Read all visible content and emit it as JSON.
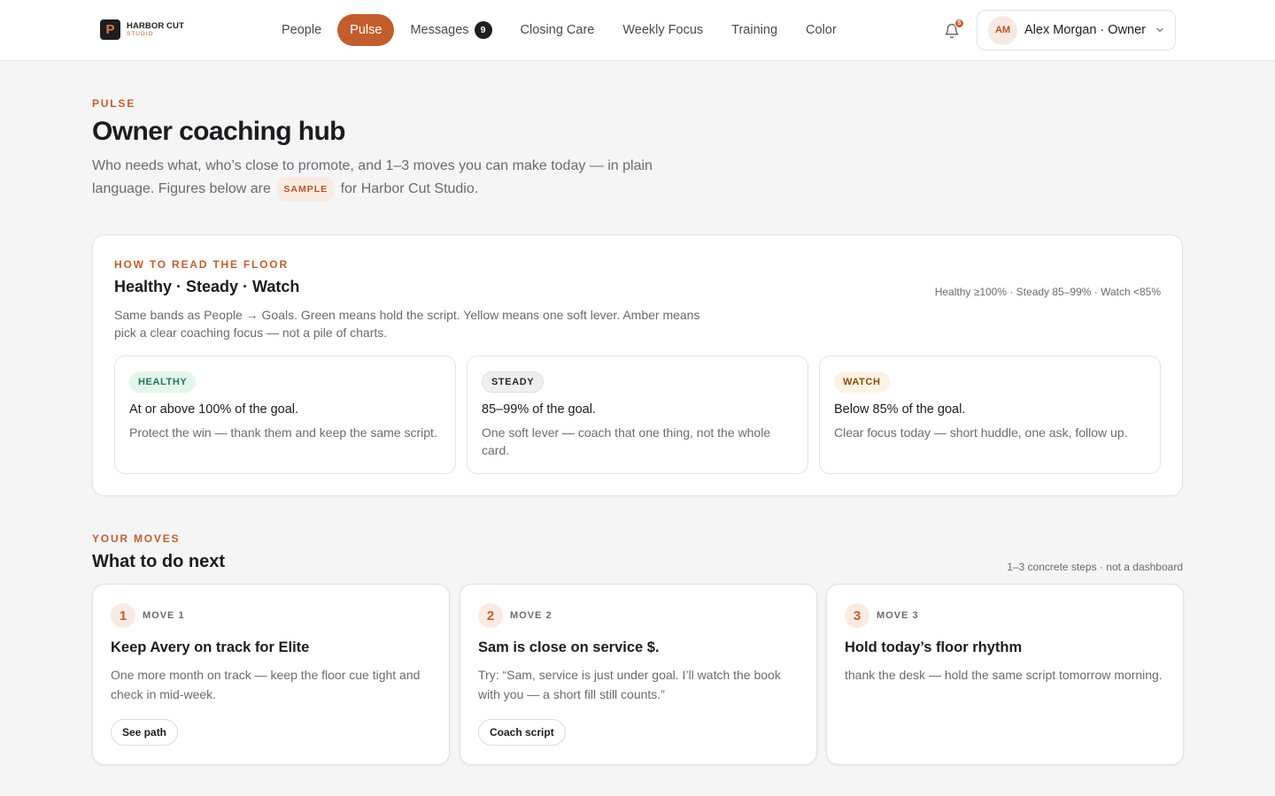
{
  "brand": {
    "mark": "P",
    "name": "HARBOR CUT",
    "sub": "STUDIO"
  },
  "nav": {
    "items": [
      {
        "label": "People"
      },
      {
        "label": "Pulse",
        "active": true
      },
      {
        "label": "Messages",
        "badge": "9"
      },
      {
        "label": "Closing Care"
      },
      {
        "label": "Weekly Focus"
      },
      {
        "label": "Training"
      },
      {
        "label": "Color"
      }
    ]
  },
  "notifications": {
    "count": "5"
  },
  "account": {
    "initials": "AM",
    "name": "Alex Morgan · Owner"
  },
  "hero": {
    "eyebrow": "PULSE",
    "title": "Owner coaching hub",
    "desc_before": "Who needs what, who’s close to promote, and 1–3 moves you can make today — in plain language. Figures below are",
    "sample": "SAMPLE",
    "desc_after": "for Harbor Cut Studio."
  },
  "floor": {
    "eyebrow": "HOW TO READ THE FLOOR",
    "title": "Healthy · Steady · Watch",
    "bands_note": "Healthy ≥100% · Steady 85–99% · Watch <85%",
    "desc": "Same bands as People → Goals. Green means hold the script. Yellow means one soft lever. Amber means pick a clear coaching focus — not a pile of charts.",
    "bands": [
      {
        "label": "HEALTHY",
        "head": "At or above 100% of the goal.",
        "text": "Protect the win — thank them and keep the same script."
      },
      {
        "label": "STEADY",
        "head": "85–99% of the goal.",
        "text": "One soft lever — coach that one thing, not the whole card."
      },
      {
        "label": "WATCH",
        "head": "Below 85% of the goal.",
        "text": "Clear focus today — short huddle, one ask, follow up."
      }
    ]
  },
  "moves": {
    "eyebrow": "YOUR MOVES",
    "title": "What to do next",
    "note": "1–3 concrete steps · not a dashboard",
    "items": [
      {
        "num": "1",
        "label": "MOVE 1",
        "title": "Keep Avery on track for Elite",
        "text": "One more month on track — keep the floor cue tight and check in mid-week.",
        "button": "See path"
      },
      {
        "num": "2",
        "label": "MOVE 2",
        "title": "Sam is close on service $.",
        "text": "Try: “Sam, service is just under goal. I’ll watch the book with you — a short fill still counts.”",
        "button": "Coach script"
      },
      {
        "num": "3",
        "label": "MOVE 3",
        "title": "Hold today’s floor rhythm",
        "text": "thank the desk — hold the same script tomorrow morning."
      }
    ]
  },
  "colors": {
    "accent": "#c25e2e",
    "healthy": "#1f7a52",
    "watch": "#8a4b12"
  }
}
